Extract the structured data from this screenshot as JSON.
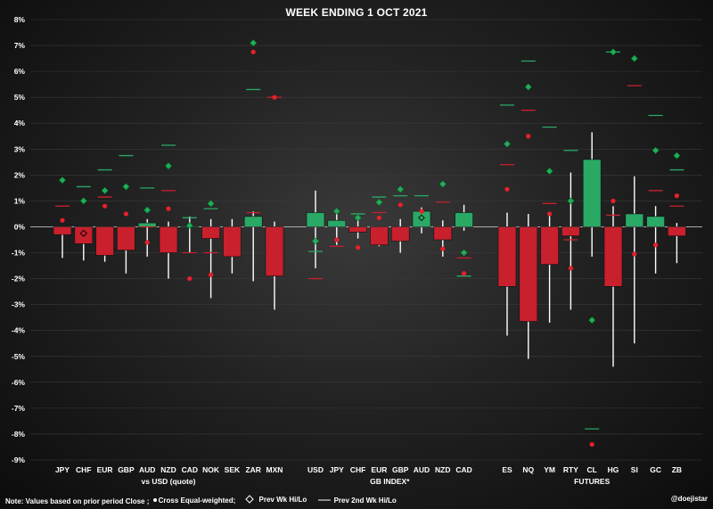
{
  "footer": {
    "note": "Note:  Values based on prior period Close ;",
    "legend": [
      "Cross Equal-weighted;",
      "Prev Wk Hi/Lo",
      "Prev 2nd Wk Hi/Lo"
    ],
    "author": "@doejistar"
  },
  "chart_data": {
    "type": "candlestick",
    "title": "WEEK ENDING  1 OCT 2021",
    "ylim": [
      -9,
      8
    ],
    "yticks": [
      "8%",
      "7%",
      "6%",
      "5%",
      "4%",
      "3%",
      "2%",
      "1%",
      "0%",
      "-1%",
      "-2%",
      "-3%",
      "-4%",
      "-5%",
      "-6%",
      "-7%",
      "-8%",
      "-9%"
    ],
    "colors": {
      "up": "#2aa866",
      "down": "#c8202c",
      "prev_wk": "#2aa866",
      "cross_ew": "#e8202c",
      "prev2": "#2aa866"
    },
    "groups": [
      {
        "label": "vs USD (quote)",
        "items": [
          {
            "label": "JPY",
            "close": -0.3,
            "high": 0.0,
            "low": -1.2,
            "cross_ew": 0.25,
            "cross_ew_color": "red",
            "prev_wk": 1.8,
            "prev_wk_color": "green",
            "prev2": 0.8,
            "prev2_color": "red"
          },
          {
            "label": "CHF",
            "close": -0.65,
            "high": 0.0,
            "low": -1.3,
            "cross_ew": null,
            "prev_wk": 1.0,
            "prev_wk_color": "green",
            "prev_wk2": -0.25,
            "prev2": 1.55,
            "prev2_color": "green"
          },
          {
            "label": "EUR",
            "close": -1.1,
            "high": 0.0,
            "low": -1.35,
            "cross_ew": 0.8,
            "cross_ew_color": "red",
            "prev_wk": 1.4,
            "prev_wk_color": "green",
            "prev2": 2.2,
            "prev2_color": "green",
            "prev2b": 1.15,
            "prev2b_color": "red"
          },
          {
            "label": "GBP",
            "close": -0.9,
            "high": 0.0,
            "low": -1.8,
            "cross_ew": 0.5,
            "cross_ew_color": "red",
            "prev_wk": 1.55,
            "prev_wk_color": "green",
            "prev2": 2.75,
            "prev2_color": "green"
          },
          {
            "label": "AUD",
            "close": 0.15,
            "high": 0.3,
            "low": -1.15,
            "cross_ew": -0.6,
            "cross_ew_color": "red",
            "prev_wk": 0.65,
            "prev_wk_color": "green",
            "prev2": 1.5,
            "prev2_color": "green",
            "prev2b": 0.0,
            "prev2b_color": "red"
          },
          {
            "label": "NZD",
            "close": -1.0,
            "high": 0.2,
            "low": -2.0,
            "cross_ew": 0.7,
            "cross_ew_color": "red",
            "prev_wk": 2.35,
            "prev_wk_color": "green",
            "prev2": 3.15,
            "prev2_color": "green",
            "prev2b": 1.4,
            "prev2b_color": "red"
          },
          {
            "label": "CAD",
            "close": 0.0,
            "high": 0.4,
            "low": -1.0,
            "cross_ew": -2.0,
            "cross_ew_color": "red",
            "prev_wk": 0.05,
            "prev_wk_color": "green",
            "prev2": -1.0,
            "prev2_color": "red",
            "prev2b": 0.35,
            "prev2b_color": "green"
          },
          {
            "label": "NOK",
            "close": -0.45,
            "high": 0.3,
            "low": -2.75,
            "cross_ew": -1.85,
            "cross_ew_color": "red",
            "prev_wk": 0.9,
            "prev_wk_color": "green",
            "prev2": -1.0,
            "prev2_color": "red",
            "prev2b": 0.7,
            "prev2b_color": "green"
          },
          {
            "label": "SEK",
            "close": -1.15,
            "high": 0.3,
            "low": -1.8,
            "cross_ew": null,
            "prev_wk": null,
            "prev2": null
          },
          {
            "label": "ZAR",
            "close": 0.4,
            "high": 0.6,
            "low": -2.1,
            "cross_ew": 6.75,
            "cross_ew_color": "red",
            "prev_wk": 7.1,
            "prev_wk_color": "green",
            "prev2": 5.3,
            "prev2_color": "green",
            "prev2b": 0.55,
            "prev2b_color": "red"
          },
          {
            "label": "MXN",
            "close": -1.9,
            "high": 0.2,
            "low": -3.2,
            "cross_ew": 5.0,
            "cross_ew_color": "red",
            "prev_wk": null,
            "prev2": 5.0,
            "prev2_color": "red"
          }
        ]
      },
      {
        "label": "GB INDEX*",
        "items": [
          {
            "label": "USD",
            "close": 0.55,
            "high": 1.4,
            "low": -1.6,
            "cross_ew": -0.55,
            "cross_ew_color": "green",
            "prev_wk": -0.55,
            "prev_wk_color": "green",
            "prev2": -0.95,
            "prev2_color": "green",
            "prev2b": -2.0,
            "prev2b_color": "red"
          },
          {
            "label": "JPY",
            "close": 0.25,
            "high": 0.55,
            "low": -0.7,
            "cross_ew": -0.5,
            "cross_ew_color": "red",
            "prev_wk": 0.6,
            "prev_wk_color": "green",
            "prev2": -0.75,
            "prev2_color": "red"
          },
          {
            "label": "CHF",
            "close": -0.2,
            "high": 0.35,
            "low": -0.45,
            "cross_ew": -0.8,
            "cross_ew_color": "red",
            "prev_wk": 0.35,
            "prev_wk_color": "green",
            "prev2": 0.5,
            "prev2_color": "green"
          },
          {
            "label": "EUR",
            "close": -0.7,
            "high": 0.0,
            "low": -0.75,
            "cross_ew": 0.35,
            "cross_ew_color": "red",
            "prev_wk": 0.95,
            "prev_wk_color": "green",
            "prev2": 1.15,
            "prev2_color": "green",
            "prev2b": 0.55,
            "prev2b_color": "red"
          },
          {
            "label": "GBP",
            "close": -0.55,
            "high": 0.3,
            "low": -1.0,
            "cross_ew": 0.85,
            "cross_ew_color": "red",
            "prev_wk": 1.45,
            "prev_wk_color": "green",
            "prev2": 1.2,
            "prev2_color": "green"
          },
          {
            "label": "AUD",
            "close": 0.6,
            "high": 0.75,
            "low": -0.25,
            "cross_ew": 0.6,
            "cross_ew_color": "red",
            "prev_wk": 0.35,
            "prev_wk_color": "diamond",
            "prev2": 1.2,
            "prev2_color": "green"
          },
          {
            "label": "NZD",
            "close": -0.5,
            "high": 0.25,
            "low": -1.15,
            "cross_ew": -0.85,
            "cross_ew_color": "red",
            "prev_wk": 1.65,
            "prev_wk_color": "green",
            "prev2": 0.95,
            "prev2_color": "red"
          },
          {
            "label": "CAD",
            "close": 0.55,
            "high": 0.85,
            "low": -0.15,
            "cross_ew": -1.8,
            "cross_ew_color": "red",
            "prev_wk": -1.0,
            "prev_wk_color": "green",
            "prev2": -1.9,
            "prev2_color": "green",
            "prev2b": -1.2,
            "prev2b_color": "red"
          }
        ]
      },
      {
        "label": "FUTURES",
        "items": [
          {
            "label": "ES",
            "close": -2.3,
            "high": 0.55,
            "low": -4.2,
            "cross_ew": 1.45,
            "cross_ew_color": "red",
            "prev_wk": 3.2,
            "prev_wk_color": "green",
            "prev2": 4.7,
            "prev2_color": "green",
            "prev2b": 2.4,
            "prev2b_color": "red"
          },
          {
            "label": "NQ",
            "close": -3.65,
            "high": 0.5,
            "low": -5.1,
            "cross_ew": 3.5,
            "cross_ew_color": "red",
            "prev_wk": 5.4,
            "prev_wk_color": "green",
            "prev2": 6.4,
            "prev2_color": "green",
            "prev2b": 4.5,
            "prev2b_color": "red"
          },
          {
            "label": "YM",
            "close": -1.45,
            "high": 0.45,
            "low": -3.7,
            "cross_ew": 0.5,
            "cross_ew_color": "red",
            "prev_wk": 2.15,
            "prev_wk_color": "green",
            "prev2": 3.85,
            "prev2_color": "green",
            "prev2b": 0.9,
            "prev2b_color": "red"
          },
          {
            "label": "RTY",
            "close": -0.35,
            "high": 2.1,
            "low": -3.2,
            "cross_ew": -1.6,
            "cross_ew_color": "red",
            "prev_wk": 1.0,
            "prev_wk_color": "green",
            "prev2": 2.95,
            "prev2_color": "green",
            "prev2b": -0.5,
            "prev2b_color": "red"
          },
          {
            "label": "CL",
            "close": 2.6,
            "high": 3.65,
            "low": -1.15,
            "cross_ew": -8.4,
            "cross_ew_color": "red",
            "prev_wk": -3.6,
            "prev_wk_color": "green",
            "prev2": -7.8,
            "prev2_color": "green"
          },
          {
            "label": "HG",
            "close": -2.3,
            "high": 0.8,
            "low": -5.4,
            "cross_ew": 1.0,
            "cross_ew_color": "red",
            "prev_wk": 6.75,
            "prev_wk_color": "green",
            "prev2": 6.75,
            "prev2_color": "green",
            "prev2b": 0.45,
            "prev2b_color": "red"
          },
          {
            "label": "SI",
            "close": 0.5,
            "high": 1.95,
            "low": -4.5,
            "cross_ew": -1.05,
            "cross_ew_color": "red",
            "prev_wk": 6.5,
            "prev_wk_color": "green",
            "prev2": 5.45,
            "prev2_color": "red"
          },
          {
            "label": "GC",
            "close": 0.4,
            "high": 0.8,
            "low": -1.8,
            "cross_ew": -0.7,
            "cross_ew_color": "red",
            "prev_wk": 2.95,
            "prev_wk_color": "green",
            "prev2": 4.3,
            "prev2_color": "green",
            "prev2b": 1.4,
            "prev2b_color": "red"
          },
          {
            "label": "ZB",
            "close": -0.35,
            "high": 0.15,
            "low": -1.4,
            "cross_ew": 1.2,
            "cross_ew_color": "red",
            "prev_wk": 2.75,
            "prev_wk_color": "green",
            "prev2": 2.2,
            "prev2_color": "green",
            "prev2b": 0.8,
            "prev2b_color": "red"
          }
        ]
      }
    ]
  }
}
